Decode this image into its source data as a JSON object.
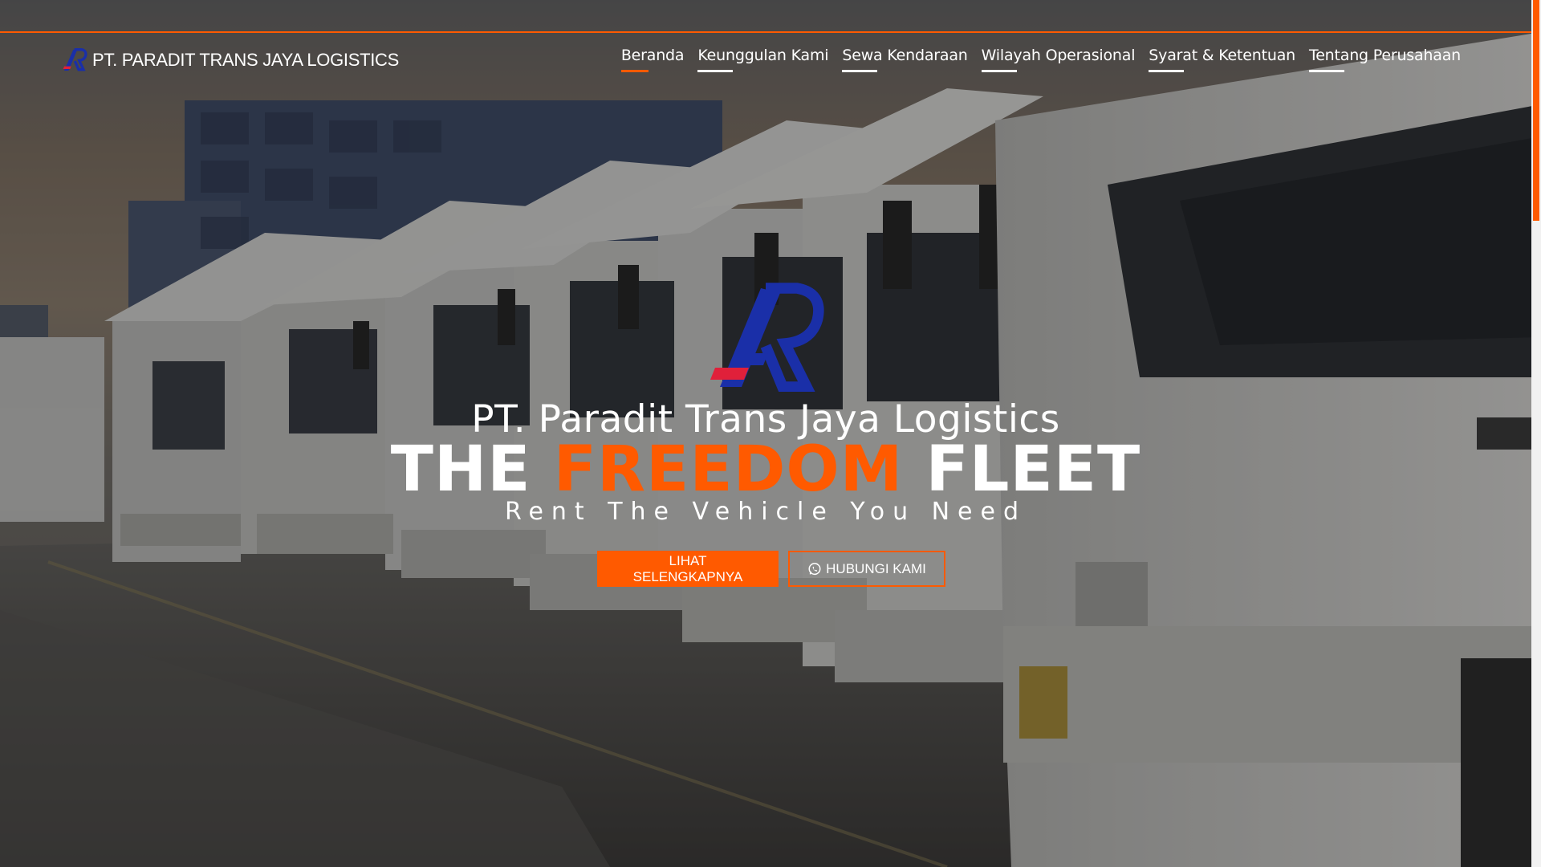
{
  "header": {
    "brand_name": "PT. PARADIT TRANS JAYA LOGISTICS",
    "nav": [
      {
        "label": "Beranda",
        "active": true
      },
      {
        "label": "Keunggulan Kami",
        "active": false
      },
      {
        "label": "Sewa Kendaraan",
        "active": false
      },
      {
        "label": "Wilayah Operasional",
        "active": false
      },
      {
        "label": "Syarat & Ketentuan",
        "active": false
      },
      {
        "label": "Tentang Perusahaan",
        "active": false
      }
    ]
  },
  "hero": {
    "company": "PT. Paradit Trans Jaya Logistics",
    "title_part1": "THE",
    "title_accent": "FREEDOM",
    "title_part2": "FLEET",
    "tagline": "Rent The Vehicle You Need",
    "primary_button": "LIHAT SELENGKAPNYA",
    "secondary_button": "HUBUNGI KAMI",
    "secondary_button_icon": "whatsapp-icon"
  },
  "colors": {
    "accent": "#ff5a00",
    "logo_blue": "#1a2fa8",
    "logo_red": "#e0203a",
    "text": "#ffffff"
  },
  "icons": {
    "brand_logo": "pr-monogram-logo",
    "hero_logo": "pr-monogram-logo"
  }
}
